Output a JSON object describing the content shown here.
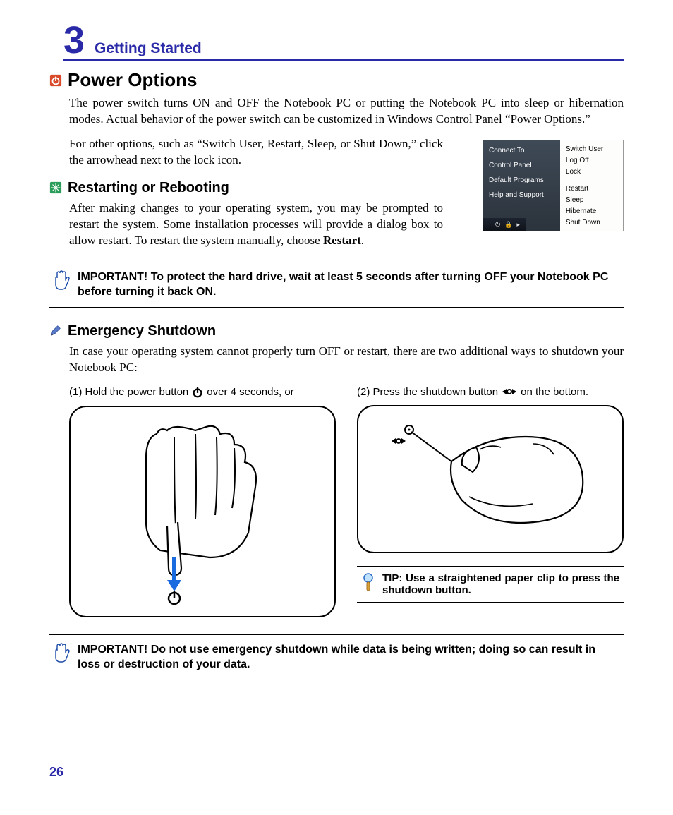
{
  "chapter": {
    "number": "3",
    "title": "Getting Started"
  },
  "sec_power": {
    "heading": "Power Options",
    "p1": "The power switch turns ON and OFF the Notebook PC or putting the Notebook PC into sleep or hibernation modes. Actual behavior of the power switch can be customized in Windows Control Panel “Power Options.”",
    "p2": "For other options, such as “Switch User, Restart, Sleep, or Shut Down,” click the arrowhead next to the lock icon."
  },
  "start_menu": {
    "left": [
      "Connect To",
      "Control Panel",
      "Default Programs",
      "Help and Support"
    ],
    "right_top": [
      "Switch User",
      "Log Off",
      "Lock"
    ],
    "right_bottom": [
      "Restart",
      "Sleep",
      "Hibernate",
      "Shut Down"
    ]
  },
  "sec_restart": {
    "heading": "Restarting or Rebooting",
    "p1_a": "After making changes to your operating system, you may be prompted to restart the system. Some installation processes will provide a dialog box to allow restart. To restart the system manually, choose ",
    "p1_b": "Restart",
    "p1_c": "."
  },
  "callout1": "IMPORTANT!  To protect the hard drive, wait at least 5 seconds after turning OFF your Notebook PC before turning it back ON.",
  "sec_emg": {
    "heading": "Emergency Shutdown",
    "p1": "In case your operating system cannot properly turn OFF or restart, there are two additional ways to shutdown your Notebook PC:",
    "opt1_a": "(1) Hold the power button",
    "opt1_b": "over 4 seconds, or",
    "opt2_a": "(2) Press the shutdown button",
    "opt2_b": "on the bottom."
  },
  "tip": "TIP: Use a straightened paper clip to press the shutdown button.",
  "callout2": "IMPORTANT!  Do not use emergency shutdown while data is being written; doing so can result in loss or destruction of your data.",
  "page_number": "26"
}
